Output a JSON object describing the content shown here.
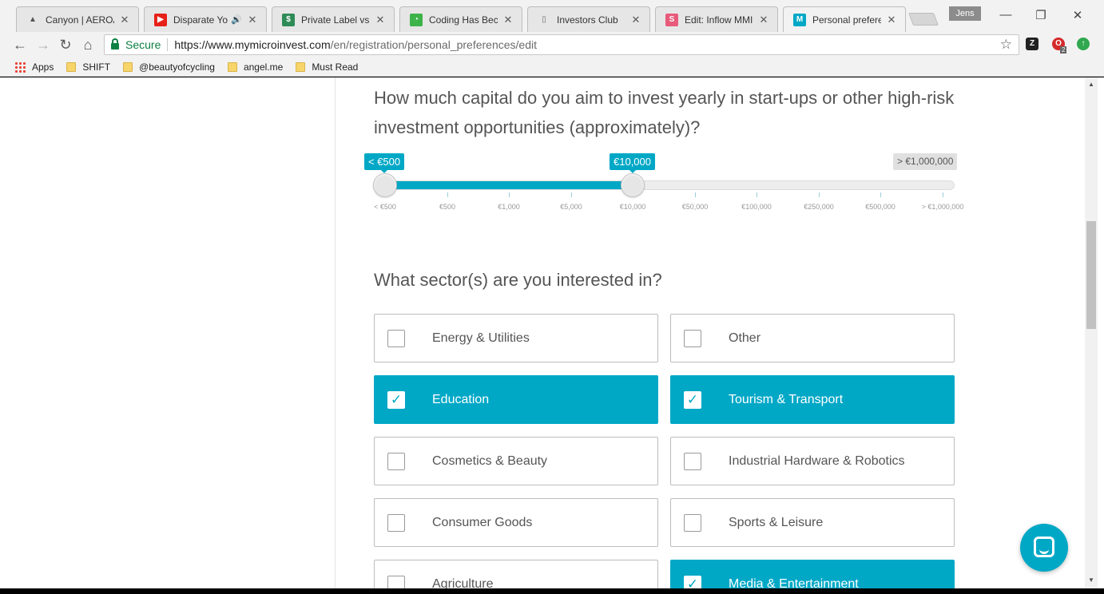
{
  "browser": {
    "tabs": [
      {
        "title": "Canyon | AEROAD",
        "favicon": "mountain-icon",
        "color": "#555555"
      },
      {
        "title": "Disparate Youth",
        "favicon": "youtube-icon",
        "color": "#e62117",
        "audio": true
      },
      {
        "title": "Private Label vs Re",
        "favicon": "dollar-icon",
        "color": "#2e8b57"
      },
      {
        "title": "Coding Has Becom",
        "favicon": "timer-icon",
        "color": "#3cb34a"
      },
      {
        "title": "Investors Club",
        "favicon": "document-icon",
        "color": "#999999"
      },
      {
        "title": "Edit: Inflow MMI -",
        "favicon": "s-icon",
        "color": "#e85a7a"
      },
      {
        "title": "Personal preferenc",
        "favicon": "m-icon",
        "color": "#00a8c6",
        "active": true
      }
    ],
    "profile_name": "Jens",
    "address": {
      "secure_label": "Secure",
      "url_host": "https://www.mymicroinvest.com",
      "url_path": "/en/registration/personal_preferences/edit"
    },
    "bookmarks": [
      {
        "label": "Apps",
        "icon": "apps-grid-icon"
      },
      {
        "label": "SHIFT",
        "icon": "folder-icon"
      },
      {
        "label": "@beautyofcycling",
        "icon": "folder-icon"
      },
      {
        "label": "angel.me",
        "icon": "folder-icon"
      },
      {
        "label": "Must Read",
        "icon": "folder-icon"
      }
    ],
    "extensions": [
      "kindle-icon",
      "opera-icon",
      "update-icon"
    ],
    "extension_badge": "2"
  },
  "form": {
    "capital_question": "How much capital do you aim to invest yearly in start-ups or other high-risk investment opportunities (approximately)?",
    "slider": {
      "min_label": "< €500",
      "current_label": "€10,000",
      "max_label": "> €1,000,000",
      "ticks": [
        "< €500",
        "€500",
        "€1,000",
        "€5,000",
        "€10,000",
        "€50,000",
        "€100,000",
        "€250,000",
        "€500,000",
        "> €1,000,000"
      ],
      "selected_min_index": 0,
      "selected_max_index": 4,
      "accent_color": "#00a8c6"
    },
    "sector_question": "What sector(s) are you interested in?",
    "sectors": [
      {
        "label": "Energy & Utilities",
        "checked": false
      },
      {
        "label": "Other",
        "checked": false
      },
      {
        "label": "Education",
        "checked": true
      },
      {
        "label": "Tourism & Transport",
        "checked": true
      },
      {
        "label": "Cosmetics & Beauty",
        "checked": false
      },
      {
        "label": "Industrial Hardware & Robotics",
        "checked": false
      },
      {
        "label": "Consumer Goods",
        "checked": false
      },
      {
        "label": "Sports & Leisure",
        "checked": false
      },
      {
        "label": "Agriculture",
        "checked": false
      },
      {
        "label": "Media & Entertainment",
        "checked": true
      }
    ],
    "checkmark": "✓"
  },
  "chat": {
    "icon": "chat-icon"
  }
}
